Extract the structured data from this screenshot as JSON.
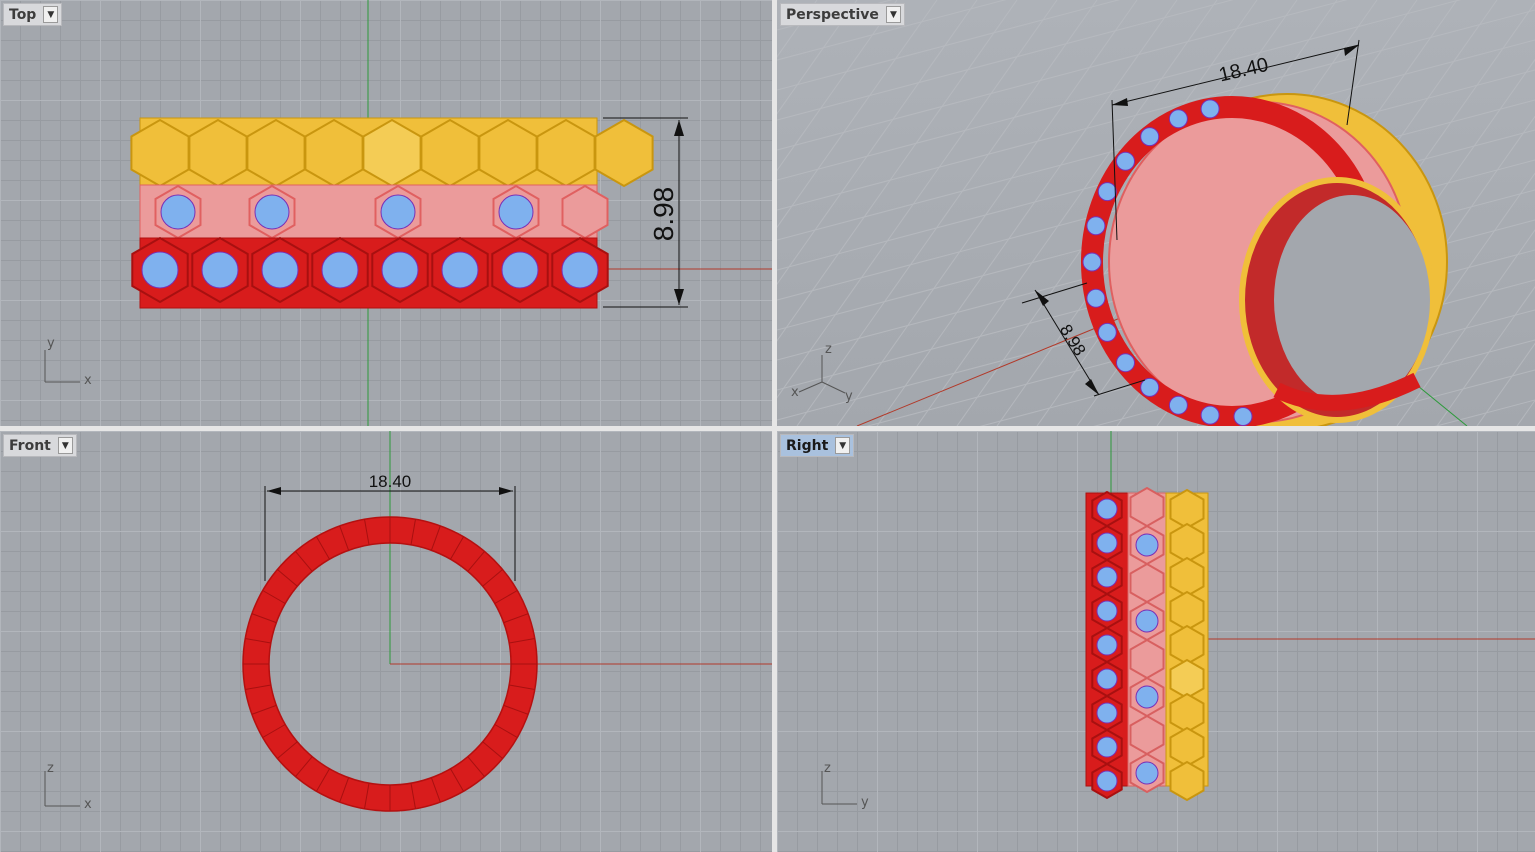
{
  "viewports": {
    "top": {
      "label": "Top",
      "dimension": "8.98",
      "axes": {
        "a": "y",
        "b": "x"
      }
    },
    "perspective": {
      "label": "Perspective",
      "dimension_width": "18.40",
      "dimension_height": "8.98",
      "axes": {
        "a": "z",
        "b": "x",
        "c": "y"
      }
    },
    "front": {
      "label": "Front",
      "dimension": "18.40",
      "axes": {
        "a": "z",
        "b": "x"
      }
    },
    "right": {
      "label": "Right",
      "dimension": "",
      "axes": {
        "a": "z",
        "b": "y"
      }
    }
  },
  "dropdown_icon": "chevron-down-icon",
  "colors": {
    "viewport_bg": "#a3a7ad",
    "grid_line": "#979ba1",
    "x_axis": "#b23a2a",
    "y_axis": "#2c9a3a",
    "ring_red": "#d81c1c",
    "ring_gold": "#f0bf3a",
    "ring_pink": "#eb9b9b",
    "gem_blue": "#7fb1ee",
    "gem_purple": "#7a2fb5",
    "active_label": "#a9c1de"
  }
}
